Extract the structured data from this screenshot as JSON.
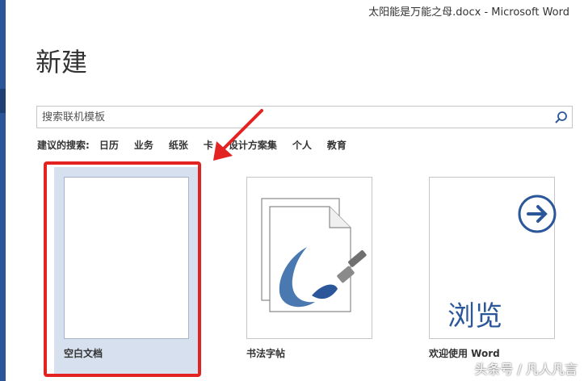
{
  "window": {
    "title": "太阳能是万能之母.docx - Microsoft Word"
  },
  "page": {
    "title": "新建"
  },
  "search": {
    "placeholder": "搜索联机模板",
    "value": ""
  },
  "suggestions": {
    "label": "建议的搜索:",
    "items": [
      "日历",
      "业务",
      "纸张",
      "卡",
      "设计方案集",
      "个人",
      "教育"
    ]
  },
  "templates": [
    {
      "label": "空白文档",
      "selected": true
    },
    {
      "label": "书法字帖"
    },
    {
      "label": "欢迎使用 Word",
      "thumb_text": "浏览"
    }
  ],
  "watermark": {
    "text": "头条号 / 凡人凡言"
  },
  "colors": {
    "accent": "#2b579a",
    "highlight": "#e32222",
    "selected_tile": "#d7e0ef"
  },
  "icons": {
    "search": "search-icon",
    "arrow": "arrow-circle-right-icon",
    "brush": "brush-icon"
  }
}
